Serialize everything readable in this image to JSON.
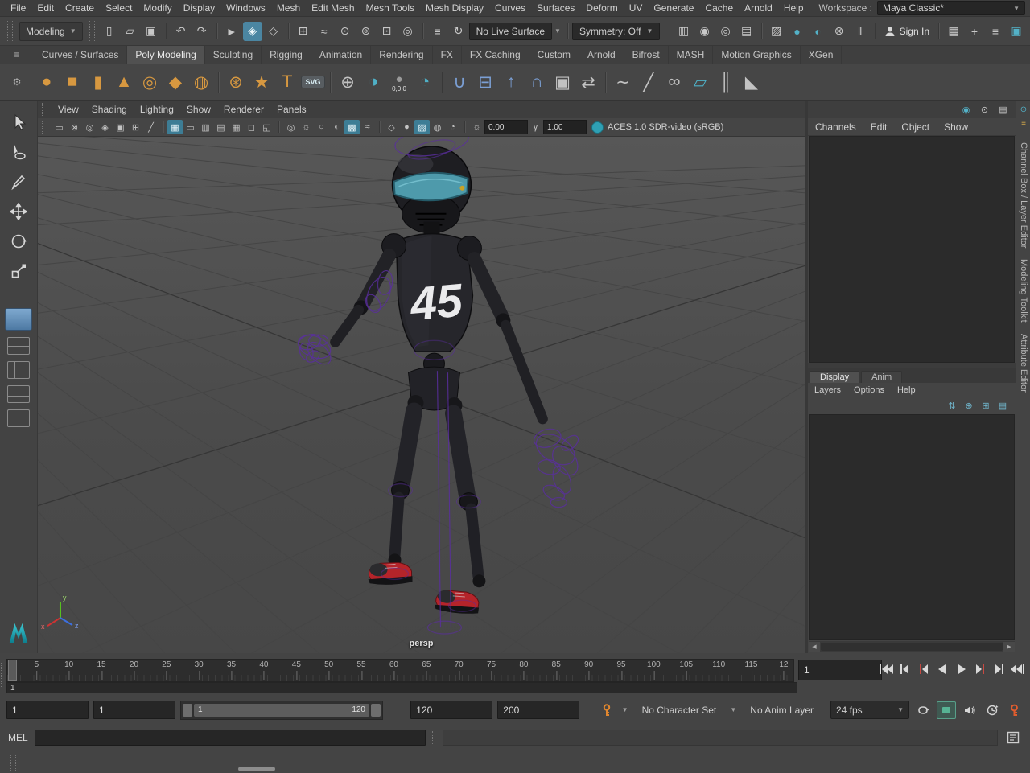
{
  "colors": {
    "accent_teal": "#4b86a2",
    "shelf_orange": "#d79840",
    "visor_teal": "#4e9aab",
    "shoe_red": "#b5242a",
    "wireframe_purple": "#5b2fa0",
    "viewport_bg": "#4c4c4c",
    "panel_dark": "#2b2b2b"
  },
  "menubar": {
    "items": [
      "File",
      "Edit",
      "Create",
      "Select",
      "Modify",
      "Display",
      "Windows",
      "Mesh",
      "Edit Mesh",
      "Mesh Tools",
      "Mesh Display",
      "Curves",
      "Surfaces",
      "Deform",
      "UV",
      "Generate",
      "Cache",
      "Arnold",
      "Help"
    ],
    "workspace_label": "Workspace :",
    "workspace_value": "Maya Classic*"
  },
  "toolbar": {
    "mode": "Modeling",
    "live_surface": "No Live Surface",
    "symmetry": "Symmetry: Off",
    "sign_in": "Sign In"
  },
  "toolbar_icons": [
    {
      "name": "new-scene",
      "glyph": "▯"
    },
    {
      "name": "open-scene",
      "glyph": "▱"
    },
    {
      "name": "save-scene",
      "glyph": "▣"
    },
    {
      "name": "undo",
      "glyph": "↶"
    },
    {
      "name": "redo",
      "glyph": "↷"
    },
    {
      "name": "select-by-hierarchy",
      "glyph": "►"
    },
    {
      "name": "select-by-object",
      "glyph": "◈"
    },
    {
      "name": "select-by-component",
      "glyph": "◇"
    },
    {
      "name": "snap-to-grid",
      "glyph": "⊞"
    },
    {
      "name": "snap-to-curve",
      "glyph": "≈"
    },
    {
      "name": "snap-to-point",
      "glyph": "⊙"
    },
    {
      "name": "snap-to-projected-center",
      "glyph": "⊚"
    },
    {
      "name": "snap-to-view-plane",
      "glyph": "⊡"
    },
    {
      "name": "make-live",
      "glyph": "◎"
    },
    {
      "name": "construction-history",
      "glyph": "≡"
    },
    {
      "name": "history-refresh",
      "glyph": "↻"
    },
    {
      "name": "render-view",
      "glyph": "▥"
    },
    {
      "name": "render-current-frame",
      "glyph": "◉"
    },
    {
      "name": "ipr-render",
      "glyph": "◎"
    },
    {
      "name": "render-setup",
      "glyph": "▤"
    },
    {
      "name": "texture-view",
      "glyph": "▨"
    },
    {
      "name": "hypershade",
      "glyph": "●"
    },
    {
      "name": "lookdev-view",
      "glyph": "◐"
    },
    {
      "name": "paint-effects",
      "glyph": "⊗"
    },
    {
      "name": "pause-viewport",
      "glyph": "‖"
    },
    {
      "name": "workspace-controls",
      "glyph": "▦"
    },
    {
      "name": "add-account",
      "glyph": "+"
    },
    {
      "name": "ui-elements",
      "glyph": "≡"
    },
    {
      "name": "toolbox-visibility",
      "glyph": "▣"
    }
  ],
  "shelf": {
    "menu_icon": "≡",
    "gear_icon": "⚙",
    "tabs": [
      "Curves / Surfaces",
      "Poly Modeling",
      "Sculpting",
      "Rigging",
      "Animation",
      "Rendering",
      "FX",
      "FX Caching",
      "Custom",
      "Arnold",
      "Bifrost",
      "MASH",
      "Motion Graphics",
      "XGen"
    ],
    "origin_caption": "0,0,0",
    "icons": [
      {
        "name": "poly-sphere",
        "glyph": "●"
      },
      {
        "name": "poly-cube",
        "glyph": "■"
      },
      {
        "name": "poly-cylinder",
        "glyph": "▮"
      },
      {
        "name": "poly-cone",
        "glyph": "▲"
      },
      {
        "name": "poly-torus",
        "glyph": "◎"
      },
      {
        "name": "poly-plane",
        "glyph": "◆"
      },
      {
        "name": "poly-disc",
        "glyph": "◍"
      },
      {
        "name": "platonic-solid",
        "glyph": "⊛"
      },
      {
        "name": "super-shape",
        "glyph": "★"
      },
      {
        "name": "poly-type",
        "glyph": "T"
      },
      {
        "name": "svg-tool",
        "glyph": "SVG"
      },
      {
        "name": "sphere-projection",
        "glyph": "⊕"
      },
      {
        "name": "boolean-tool",
        "glyph": "◑"
      },
      {
        "name": "create-at-origin",
        "glyph": "●"
      },
      {
        "name": "sweep-mesh",
        "glyph": "◔"
      },
      {
        "name": "combine",
        "glyph": "∪"
      },
      {
        "name": "separate",
        "glyph": "⊟"
      },
      {
        "name": "extrude",
        "glyph": "↑"
      },
      {
        "name": "bridge",
        "glyph": "∩"
      },
      {
        "name": "fill-hole",
        "glyph": "▣"
      },
      {
        "name": "mirror-geometry",
        "glyph": "⇄"
      },
      {
        "name": "smooth",
        "glyph": "∼"
      },
      {
        "name": "multi-cut",
        "glyph": "╱"
      },
      {
        "name": "target-weld",
        "glyph": "∞"
      },
      {
        "name": "quad-draw",
        "glyph": "▱"
      },
      {
        "name": "insert-edge-loop",
        "glyph": "║"
      },
      {
        "name": "bevel",
        "glyph": "◣"
      }
    ]
  },
  "viewport": {
    "menu": [
      "View",
      "Shading",
      "Lighting",
      "Show",
      "Renderer",
      "Panels"
    ],
    "exposure": "0.00",
    "gamma": "1.00",
    "exposure_glyph": "☼",
    "gamma_glyph": "γ",
    "colorspace": "ACES 1.0 SDR-video (sRGB)",
    "camera": "persp",
    "jersey": "45",
    "axis_labels": {
      "x": "x",
      "y": "y",
      "z": "z"
    }
  },
  "viewbar_icons": [
    {
      "name": "select-camera",
      "glyph": "▭"
    },
    {
      "name": "lock-camera",
      "glyph": "⊗"
    },
    {
      "name": "camera-attributes",
      "glyph": "◎"
    },
    {
      "name": "bookmark-view",
      "glyph": "◈"
    },
    {
      "name": "image-plane",
      "glyph": "▣"
    },
    {
      "name": "pan-zoom-2d",
      "glyph": "⊞"
    },
    {
      "name": "grease-pencil",
      "glyph": "╱"
    },
    {
      "name": "grid-toggle",
      "glyph": "▦"
    },
    {
      "name": "film-gate",
      "glyph": "▭"
    },
    {
      "name": "resolution-gate",
      "glyph": "▥"
    },
    {
      "name": "gate-mask",
      "glyph": "▤"
    },
    {
      "name": "field-chart",
      "glyph": "▦"
    },
    {
      "name": "safe-action",
      "glyph": "◻"
    },
    {
      "name": "safe-title",
      "glyph": "◱"
    },
    {
      "name": "isolate-select",
      "glyph": "◎"
    },
    {
      "name": "lighting-all",
      "glyph": "☼"
    },
    {
      "name": "lighting-default",
      "glyph": "○"
    },
    {
      "name": "shadows",
      "glyph": "◐"
    },
    {
      "name": "screen-space-ao",
      "glyph": "▩"
    },
    {
      "name": "motion-blur",
      "glyph": "≈"
    },
    {
      "name": "wireframe-mode",
      "glyph": "◇"
    },
    {
      "name": "shaded-mode",
      "glyph": "●"
    },
    {
      "name": "textured-mode",
      "glyph": "▨"
    },
    {
      "name": "default-material",
      "glyph": "◍"
    },
    {
      "name": "xray-mode",
      "glyph": "◔"
    }
  ],
  "right_panel": {
    "top_icons": [
      {
        "name": "focus-character",
        "glyph": "◉"
      },
      {
        "name": "pin-selection",
        "glyph": "⊙"
      },
      {
        "name": "channel-settings",
        "glyph": "▤"
      }
    ],
    "channel_menu": [
      "Channels",
      "Edit",
      "Object",
      "Show"
    ],
    "layer_tabs": [
      "Display",
      "Anim"
    ],
    "layer_menu": [
      "Layers",
      "Options",
      "Help"
    ],
    "layer_icons": [
      {
        "name": "layers-sort",
        "glyph": "⇅"
      },
      {
        "name": "add-layer",
        "glyph": "⊕"
      },
      {
        "name": "add-layer-from-selected",
        "glyph": "⊞"
      },
      {
        "name": "layer-options",
        "glyph": "▤"
      }
    ],
    "scroll_left": "◀",
    "scroll_right": "▶",
    "side_tabs": [
      "Channel Box / Layer Editor",
      "Modeling Toolkit",
      "Attribute Editor"
    ],
    "side_icons": [
      {
        "name": "pin",
        "glyph": "⊙"
      },
      {
        "name": "menu",
        "glyph": "≡"
      }
    ]
  },
  "timeline": {
    "ticks": [
      "5",
      "10",
      "15",
      "20",
      "25",
      "30",
      "35",
      "40",
      "45",
      "50",
      "55",
      "60",
      "65",
      "70",
      "75",
      "80",
      "85",
      "90",
      "95",
      "100",
      "105",
      "110",
      "115",
      "12"
    ],
    "playhead": "1",
    "current_frame": "1"
  },
  "range": {
    "anim_start": "1",
    "play_start": "1",
    "range_start": "1",
    "range_end": "120",
    "play_end": "120",
    "anim_end": "200",
    "character_set": "No Character Set",
    "anim_layer": "No Anim Layer",
    "fps": "24 fps"
  },
  "command_line": {
    "label": "MEL"
  }
}
